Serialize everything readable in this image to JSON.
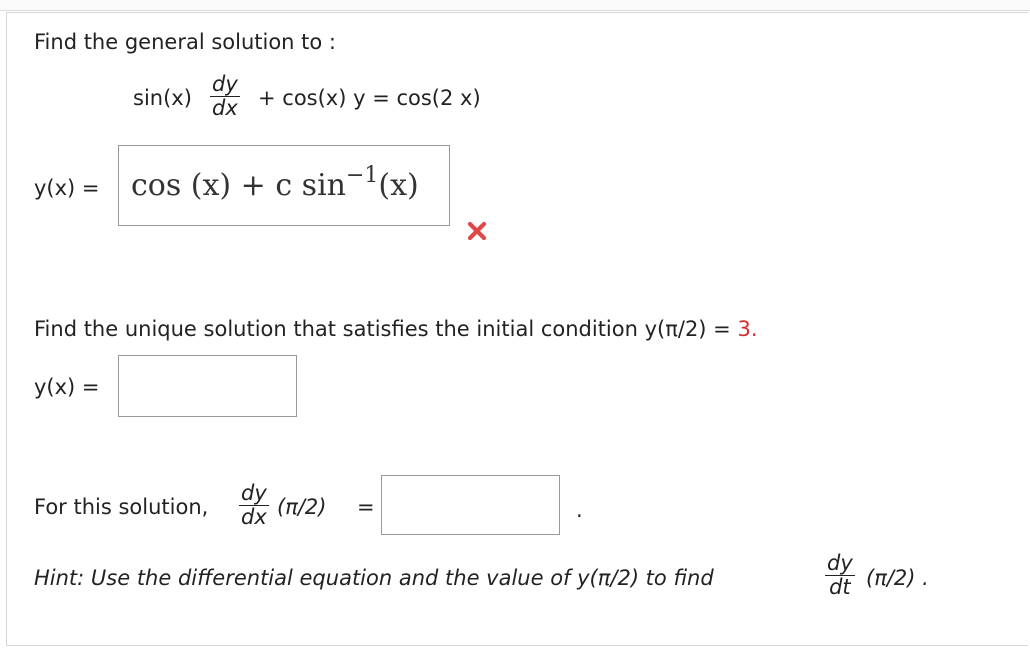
{
  "q1": {
    "prompt": "Find the general solution to :",
    "equation": {
      "sin_part": "sin(x)",
      "dy": "dy",
      "dx": "dx",
      "rest": "+ cos(x) y = cos(2 x)"
    },
    "answer_label": "y(x)  =",
    "answer_value": "cos (x) + c  sin",
    "answer_sup": "−1",
    "answer_tail": "(x)",
    "status_icon": "x-mark-icon",
    "status_color": "#e04848"
  },
  "q2": {
    "prompt": "Find the unique solution that satisfies the initial condition y(π/2)  =",
    "initial_value": "3.",
    "initial_value_color": "#d32f2f",
    "answer_label": "y(x)  =",
    "answer_value": ""
  },
  "q3": {
    "prompt_prefix": "For this solution,",
    "dy": "dy",
    "dx": "dx",
    "arg": "(π/2)",
    "equals": "=",
    "answer_value": "",
    "trailing": "."
  },
  "hint": {
    "text": "Hint: Use the differential equation and the value of  y(π/2)  to find",
    "dy": "dy",
    "dt": "dt",
    "arg": "(π/2) ."
  }
}
